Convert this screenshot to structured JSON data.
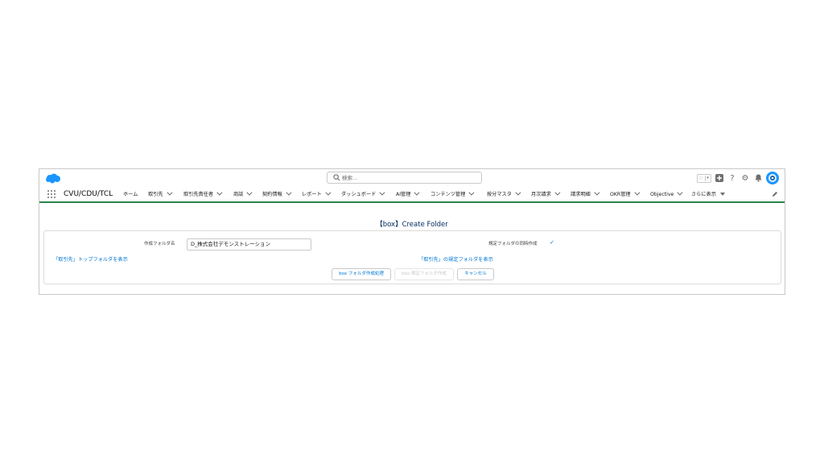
{
  "header": {
    "search_placeholder": "検索..."
  },
  "nav": {
    "app_name": "CVU/CDU/TCL",
    "items": [
      {
        "label": "ホーム"
      },
      {
        "label": "取引先"
      },
      {
        "label": "取引先責任者"
      },
      {
        "label": "商談"
      },
      {
        "label": "契約情報"
      },
      {
        "label": "レポート"
      },
      {
        "label": "ダッシュボード"
      },
      {
        "label": "AI管理"
      },
      {
        "label": "コンテンツ管理"
      },
      {
        "label": "按分マスタ"
      },
      {
        "label": "月次請求"
      },
      {
        "label": "請求明細"
      },
      {
        "label": "OKR管理"
      },
      {
        "label": "Objective"
      },
      {
        "label": "さらに表示"
      }
    ]
  },
  "page": {
    "title": "【box】Create Folder",
    "folder_name_label": "作成フォルダ名",
    "folder_name_value": "D_株式会社デモンストレーション",
    "sync_label": "規定フォルダの同時作成",
    "sync_checked": true,
    "link_top": "「取引先」トップフォルダを表示",
    "link_default": "「取引先」の規定フォルダを表示",
    "btn_create": "box フォルダ作成処理",
    "btn_create_default": "box 規定フォルダ作成",
    "btn_cancel": "キャンセル"
  },
  "colors": {
    "brand": "#1b96ff",
    "link": "#0176d3",
    "nav_underline": "#2e844a",
    "title": "#032d60"
  }
}
